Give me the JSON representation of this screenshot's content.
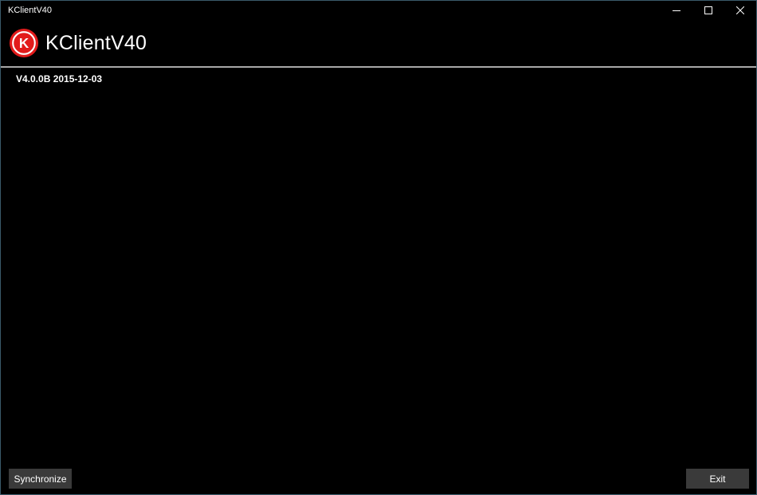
{
  "window": {
    "title": "KClientV40"
  },
  "header": {
    "app_name": "KClientV40",
    "logo_letter": "K",
    "logo_color": "#e21b1b"
  },
  "main": {
    "version_text": "V4.0.0B 2015-12-03"
  },
  "footer": {
    "synchronize_label": "Synchronize",
    "exit_label": "Exit"
  },
  "icons": {
    "minimize": "minimize-icon",
    "maximize": "maximize-icon",
    "close": "close-icon"
  }
}
